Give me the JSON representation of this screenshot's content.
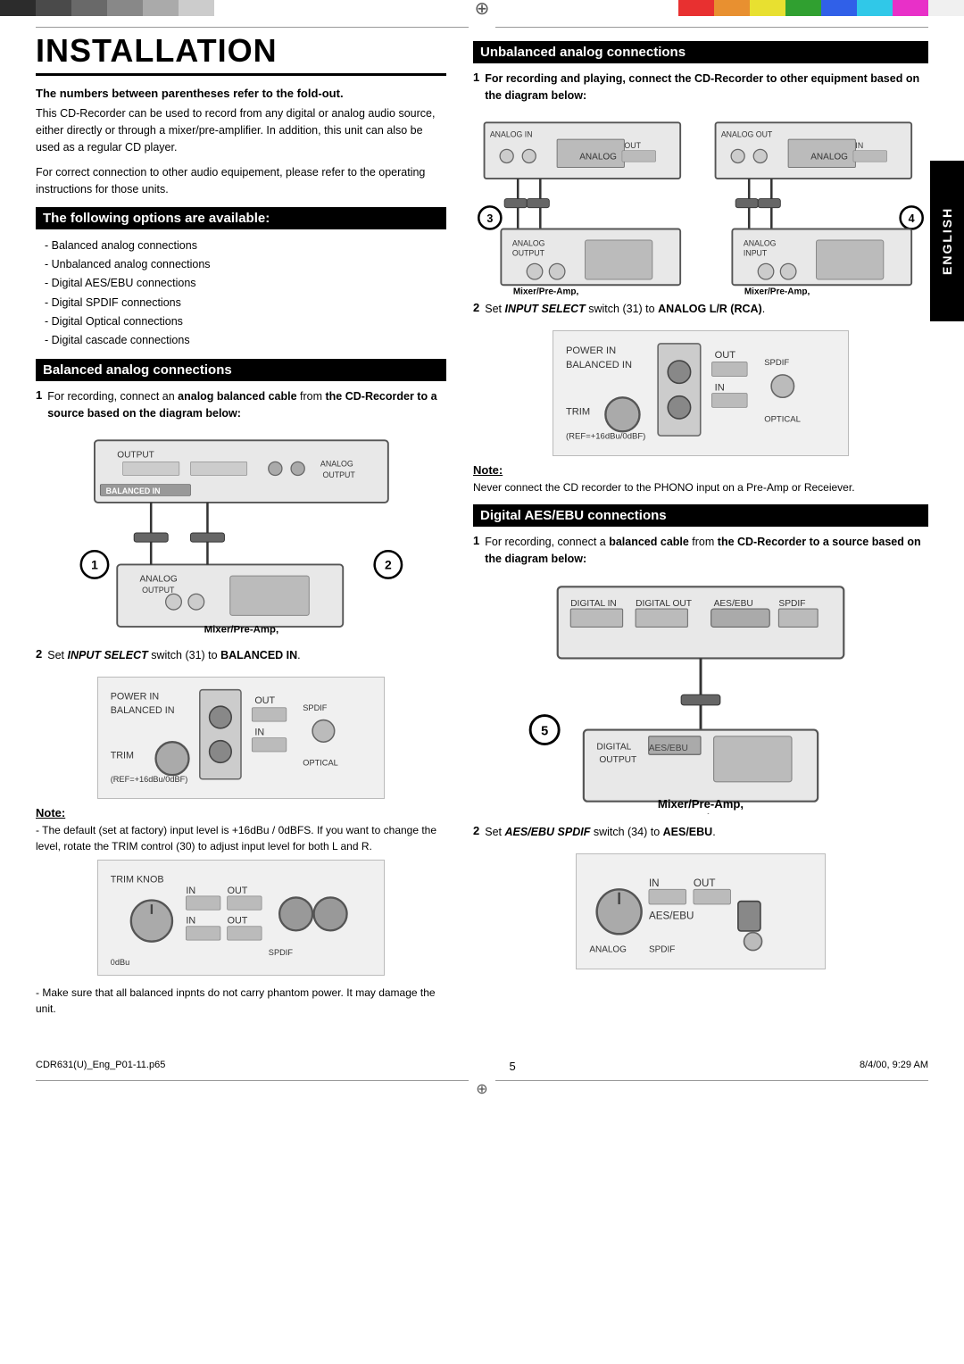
{
  "topBar": {
    "leftColors": [
      "#2c2c2c",
      "#4a4a4a",
      "#696969",
      "#888",
      "#aaa",
      "#ccc"
    ],
    "rightColors": [
      "#e83030",
      "#e89030",
      "#e8e030",
      "#30a030",
      "#3060e8",
      "#30c8e8",
      "#e830c8",
      "#f0f0f0"
    ]
  },
  "english": "ENGLISH",
  "title": "INSTALLATION",
  "boldNote": "The numbers between parentheses refer to the fold-out.",
  "intro1": "This CD-Recorder can be used to record from any digital or analog audio source, either directly or through a mixer/pre-amplifier.  In addition, this unit can also be used as a regular CD player.",
  "intro2": "For correct connection to other audio equipement, please refer to the operating instructions for those units.",
  "section1": "The following options are available:",
  "options": [
    "Balanced analog connections",
    "Unbalanced analog connections",
    "Digital AES/EBU connections",
    "Digital SPDIF connections",
    "Digital Optical connections",
    "Digital cascade connections"
  ],
  "section2": "Balanced analog connections",
  "balancedStep1": "For recording, connect an analog balanced cable from the CD-Recorder to a source based on the diagram below:",
  "balancedDiagramLabel": "Mixer/Pre-Amp,\nDAT, CD/R,etc.",
  "balancedStep2Label": "Set INPUT SELECT switch (31) to BALANCED IN.",
  "balancedStep2Num": "2",
  "noteLabel": "Note:",
  "balancedNote": "- The default (set at factory) input level is +16dBu / 0dBFS.  If you want to change the level, rotate the TRIM control (30) to adjust input level for both L and R.",
  "balancedNote2": "- Make sure that all balanced inpnts do not carry phantom power. It may damage the unit.",
  "section3": "Unbalanced analog connections",
  "unbalancedStep1": "For recording and playing, connect the CD-Recorder to other equipment based on the diagram below:",
  "unbalancedDiagramLabel1": "Mixer/Pre-Amp,\nDAT, CD/R,etc.",
  "unbalancedDiagramLabel2": "Mixer/Pre-Amp,\nDAT, CD/R,etc.",
  "unbalancedStep2Label": "Set INPUT SELECT switch (31) to ANALOG L/R (RCA).",
  "unbalancedStep2Num": "2",
  "unbalancedNoteText": "Never connect the CD recorder to the PHONO input on a Pre-Amp or Receiever.",
  "section4": "Digital AES/EBU connections",
  "aesStep1": "For recording, connect a balanced cable from the CD-Recorder to a source based on the diagram below:",
  "aesDiagramLabel": "Mixer/Pre-Amp,\nDAT, CD/R,etc.",
  "aesStep2Label": "Set AES/EBU SPDIF switch (34) to AES/EBU.",
  "aesStep2Num": "2",
  "num1": "1",
  "num2": "2",
  "num3": "3",
  "num4": "4",
  "num5": "5",
  "footer": {
    "left": "CDR631(U)_Eng_P01-11.p65",
    "page": "5",
    "right": "8/4/00, 9:29 AM"
  }
}
